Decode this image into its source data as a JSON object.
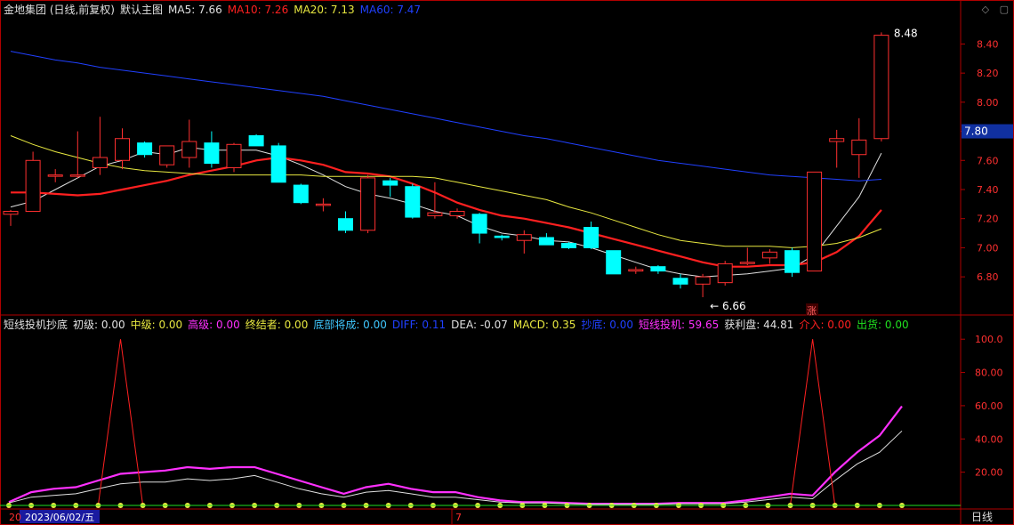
{
  "title": "金地集团 (日线,前复权)",
  "main_template": "默认主图",
  "ma": [
    {
      "label": "MA5:",
      "value": "7.66",
      "color": "#e0e0e0"
    },
    {
      "label": "MA10:",
      "value": "7.26",
      "color": "#ff2020"
    },
    {
      "label": "MA20:",
      "value": "7.13",
      "color": "#e8e840"
    },
    {
      "label": "MA60:",
      "value": "7.47",
      "color": "#2040ff"
    }
  ],
  "indicator": {
    "name": "短线投机抄底",
    "items": [
      {
        "label": "初级:",
        "value": "0.00",
        "color": "#e0e0e0"
      },
      {
        "label": "中级:",
        "value": "0.00",
        "color": "#e8e840"
      },
      {
        "label": "高级:",
        "value": "0.00",
        "color": "#ff30ff"
      },
      {
        "label": "终结者:",
        "value": "0.00",
        "color": "#e8e840"
      },
      {
        "label": "底部将成:",
        "value": "0.00",
        "color": "#40c8ff"
      },
      {
        "label": "DIFF:",
        "value": "0.11",
        "color": "#2040ff"
      },
      {
        "label": "DEA:",
        "value": "-0.07",
        "color": "#e0e0e0"
      },
      {
        "label": "MACD:",
        "value": "0.35",
        "color": "#e8e840"
      },
      {
        "label": "抄底:",
        "value": "0.00",
        "color": "#2040ff"
      },
      {
        "label": "短线投机:",
        "value": "59.65",
        "color": "#ff30ff"
      },
      {
        "label": "获利盘:",
        "value": "44.81",
        "color": "#e0e0e0"
      },
      {
        "label": "介入:",
        "value": "0.00",
        "color": "#ff2020"
      },
      {
        "label": "出货:",
        "value": "0.00",
        "color": "#20e020"
      }
    ]
  },
  "top_icons": [
    "diamond-icon",
    "window-icon"
  ],
  "current_price_tag": "7.80",
  "max_label": "8.48",
  "min_label": "6.66",
  "zhang_mark": "涨",
  "date_label": "2023/06/02/五",
  "x_axis_left": "20",
  "x_axis_mid": "7",
  "period_button": "日线",
  "colors": {
    "up": "#ff3030",
    "down": "#00ffff",
    "axis": "#b00000",
    "price_tag_bg": "#1030a0"
  },
  "chart_data": [
    {
      "type": "candlestick",
      "yticks": [
        "8.40",
        "8.20",
        "8.00",
        "7.80",
        "7.60",
        "7.40",
        "7.20",
        "7.00",
        "6.80"
      ],
      "ylim": [
        6.55,
        8.58
      ],
      "candles": [
        {
          "o": 7.23,
          "h": 7.26,
          "l": 7.15,
          "c": 7.25
        },
        {
          "o": 7.25,
          "h": 7.66,
          "l": 7.25,
          "c": 7.6
        },
        {
          "o": 7.5,
          "h": 7.54,
          "l": 7.45,
          "c": 7.5
        },
        {
          "o": 7.5,
          "h": 7.8,
          "l": 7.48,
          "c": 7.5
        },
        {
          "o": 7.55,
          "h": 7.9,
          "l": 7.5,
          "c": 7.62
        },
        {
          "o": 7.6,
          "h": 7.82,
          "l": 7.54,
          "c": 7.75
        },
        {
          "o": 7.72,
          "h": 7.73,
          "l": 7.62,
          "c": 7.64
        },
        {
          "o": 7.57,
          "h": 7.7,
          "l": 7.55,
          "c": 7.7
        },
        {
          "o": 7.62,
          "h": 7.88,
          "l": 7.55,
          "c": 7.73
        },
        {
          "o": 7.72,
          "h": 7.8,
          "l": 7.55,
          "c": 7.58
        },
        {
          "o": 7.55,
          "h": 7.72,
          "l": 7.52,
          "c": 7.71
        },
        {
          "o": 7.77,
          "h": 7.78,
          "l": 7.7,
          "c": 7.7
        },
        {
          "o": 7.7,
          "h": 7.72,
          "l": 7.45,
          "c": 7.45
        },
        {
          "o": 7.43,
          "h": 7.44,
          "l": 7.3,
          "c": 7.31
        },
        {
          "o": 7.3,
          "h": 7.34,
          "l": 7.25,
          "c": 7.3
        },
        {
          "o": 7.2,
          "h": 7.25,
          "l": 7.1,
          "c": 7.12
        },
        {
          "o": 7.12,
          "h": 7.5,
          "l": 7.1,
          "c": 7.48
        },
        {
          "o": 7.46,
          "h": 7.48,
          "l": 7.35,
          "c": 7.43
        },
        {
          "o": 7.42,
          "h": 7.44,
          "l": 7.2,
          "c": 7.21
        },
        {
          "o": 7.22,
          "h": 7.45,
          "l": 7.2,
          "c": 7.24
        },
        {
          "o": 7.22,
          "h": 7.27,
          "l": 7.2,
          "c": 7.25
        },
        {
          "o": 7.23,
          "h": 7.24,
          "l": 7.03,
          "c": 7.1
        },
        {
          "o": 7.08,
          "h": 7.09,
          "l": 7.05,
          "c": 7.07
        },
        {
          "o": 7.05,
          "h": 7.12,
          "l": 6.96,
          "c": 7.09
        },
        {
          "o": 7.07,
          "h": 7.1,
          "l": 7.02,
          "c": 7.02
        },
        {
          "o": 7.03,
          "h": 7.04,
          "l": 6.99,
          "c": 7.0
        },
        {
          "o": 7.14,
          "h": 7.18,
          "l": 6.99,
          "c": 7.0
        },
        {
          "o": 6.98,
          "h": 6.98,
          "l": 6.82,
          "c": 6.82
        },
        {
          "o": 6.84,
          "h": 6.87,
          "l": 6.82,
          "c": 6.85
        },
        {
          "o": 6.87,
          "h": 6.88,
          "l": 6.82,
          "c": 6.84
        },
        {
          "o": 6.79,
          "h": 6.82,
          "l": 6.72,
          "c": 6.75
        },
        {
          "o": 6.75,
          "h": 6.82,
          "l": 6.66,
          "c": 6.8
        },
        {
          "o": 6.76,
          "h": 6.91,
          "l": 6.74,
          "c": 6.89
        },
        {
          "o": 6.9,
          "h": 7.0,
          "l": 6.88,
          "c": 6.9
        },
        {
          "o": 6.93,
          "h": 6.99,
          "l": 6.89,
          "c": 6.97
        },
        {
          "o": 6.98,
          "h": 7.0,
          "l": 6.8,
          "c": 6.83
        },
        {
          "o": 6.84,
          "h": 7.52,
          "l": 6.84,
          "c": 7.52
        },
        {
          "o": 7.73,
          "h": 7.81,
          "l": 7.55,
          "c": 7.75
        },
        {
          "o": 7.64,
          "h": 7.89,
          "l": 7.48,
          "c": 7.74
        },
        {
          "o": 7.75,
          "h": 8.48,
          "l": 7.73,
          "c": 8.46
        }
      ],
      "ma_lines": [
        {
          "name": "MA5",
          "color": "#e0e0e0",
          "values": [
            7.28,
            7.32,
            7.4,
            7.48,
            7.56,
            7.6,
            7.66,
            7.64,
            7.69,
            7.67,
            7.67,
            7.67,
            7.63,
            7.57,
            7.5,
            7.42,
            7.37,
            7.34,
            7.3,
            7.25,
            7.22,
            7.15,
            7.1,
            7.08,
            7.05,
            7.04,
            7.0,
            6.95,
            6.9,
            6.85,
            6.82,
            6.8,
            6.81,
            6.82,
            6.84,
            6.86,
            6.95,
            7.15,
            7.35,
            7.65
          ]
        },
        {
          "name": "MA10",
          "color": "#ff2020",
          "values": [
            7.38,
            7.38,
            7.37,
            7.36,
            7.37,
            7.4,
            7.43,
            7.46,
            7.5,
            7.53,
            7.56,
            7.6,
            7.62,
            7.6,
            7.57,
            7.52,
            7.51,
            7.49,
            7.44,
            7.38,
            7.31,
            7.26,
            7.22,
            7.2,
            7.17,
            7.14,
            7.1,
            7.06,
            7.02,
            6.98,
            6.94,
            6.9,
            6.87,
            6.87,
            6.88,
            6.88,
            6.9,
            6.97,
            7.08,
            7.26
          ]
        },
        {
          "name": "MA20",
          "color": "#e8e840",
          "values": [
            7.77,
            7.71,
            7.66,
            7.62,
            7.58,
            7.55,
            7.53,
            7.52,
            7.51,
            7.5,
            7.5,
            7.5,
            7.5,
            7.5,
            7.49,
            7.49,
            7.49,
            7.49,
            7.49,
            7.48,
            7.45,
            7.42,
            7.39,
            7.36,
            7.33,
            7.28,
            7.24,
            7.19,
            7.14,
            7.09,
            7.05,
            7.03,
            7.01,
            7.01,
            7.01,
            7.0,
            7.01,
            7.03,
            7.07,
            7.13
          ]
        },
        {
          "name": "MA60",
          "color": "#2040ff",
          "values": [
            8.35,
            8.32,
            8.29,
            8.27,
            8.24,
            8.22,
            8.2,
            8.18,
            8.16,
            8.14,
            8.12,
            8.1,
            8.08,
            8.06,
            8.04,
            8.01,
            7.98,
            7.95,
            7.92,
            7.89,
            7.86,
            7.83,
            7.8,
            7.77,
            7.75,
            7.72,
            7.69,
            7.66,
            7.63,
            7.6,
            7.58,
            7.56,
            7.54,
            7.52,
            7.5,
            7.49,
            7.48,
            7.47,
            7.46,
            7.47
          ]
        }
      ]
    },
    {
      "type": "line",
      "yticks": [
        "100.0",
        "80.00",
        "60.00",
        "40.00",
        "20.00"
      ],
      "ylim": [
        0,
        106
      ],
      "series": [
        {
          "name": "短线投机",
          "color": "#ff30ff",
          "values": [
            2,
            8,
            10,
            11,
            15,
            19,
            20,
            21,
            23,
            22,
            23,
            23,
            19,
            15,
            11,
            7,
            11,
            13,
            10,
            8,
            8,
            5,
            3,
            2,
            2,
            1.5,
            1,
            1,
            1,
            1,
            1.5,
            1.5,
            1.5,
            3,
            5,
            7,
            6,
            20,
            32,
            42,
            59.65
          ]
        },
        {
          "name": "获利盘",
          "color": "#e0e0e0",
          "values": [
            1.5,
            5,
            6,
            7,
            10,
            13,
            14,
            14,
            16,
            15,
            16,
            18,
            14,
            10,
            7,
            5,
            8,
            9,
            7,
            5,
            5,
            3.5,
            2,
            1.5,
            1.5,
            1,
            0.7,
            0.7,
            0.7,
            0.7,
            1,
            1,
            1,
            2,
            3.5,
            5,
            4,
            15,
            25,
            32,
            44.81
          ]
        },
        {
          "name": "介入",
          "color": "#ff2020",
          "values": [
            0,
            0,
            0,
            0,
            0,
            100,
            0,
            0,
            0,
            0,
            0,
            0,
            0,
            0,
            0,
            0,
            0,
            0,
            0,
            0,
            0,
            0,
            0,
            0,
            0,
            0,
            0,
            0,
            0,
            0,
            0,
            0,
            0,
            0,
            0,
            0,
            100,
            0,
            0,
            0,
            0
          ]
        },
        {
          "name": "出货",
          "color": "#20e020",
          "values": [
            0,
            0,
            0,
            0,
            0,
            0,
            0,
            0,
            0,
            0,
            0,
            0,
            0,
            0,
            0,
            0,
            0,
            0,
            0,
            0,
            0,
            0,
            0,
            0,
            0,
            0,
            0,
            0,
            0,
            0,
            0,
            0,
            0,
            0,
            0,
            0,
            0,
            0,
            0,
            0,
            0
          ]
        }
      ]
    }
  ]
}
